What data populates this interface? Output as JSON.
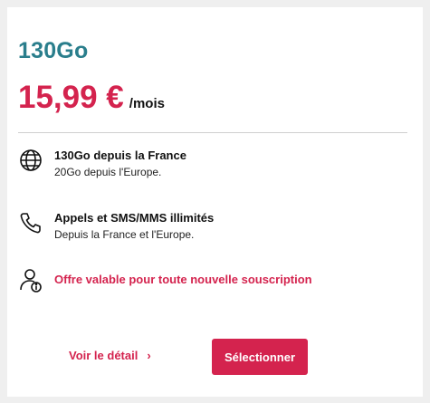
{
  "offer": {
    "name": "130Go",
    "price": "15,99 €",
    "period": "/mois"
  },
  "features": [
    {
      "icon": "globe-icon",
      "title": "130Go depuis la France",
      "subtitle": "20Go depuis l'Europe."
    },
    {
      "icon": "phone-icon",
      "title": "Appels et SMS/MMS illimités",
      "subtitle": "Depuis la France et l'Europe."
    },
    {
      "icon": "user-info-icon",
      "title": "Offre valable pour toute nouvelle souscription"
    }
  ],
  "actions": {
    "detail_label": "Voir le détail",
    "detail_chevron": "›",
    "select_label": "Sélectionner"
  },
  "colors": {
    "accent": "#d4234e",
    "plan_name": "#2a7e8c",
    "background": "#efefef"
  }
}
